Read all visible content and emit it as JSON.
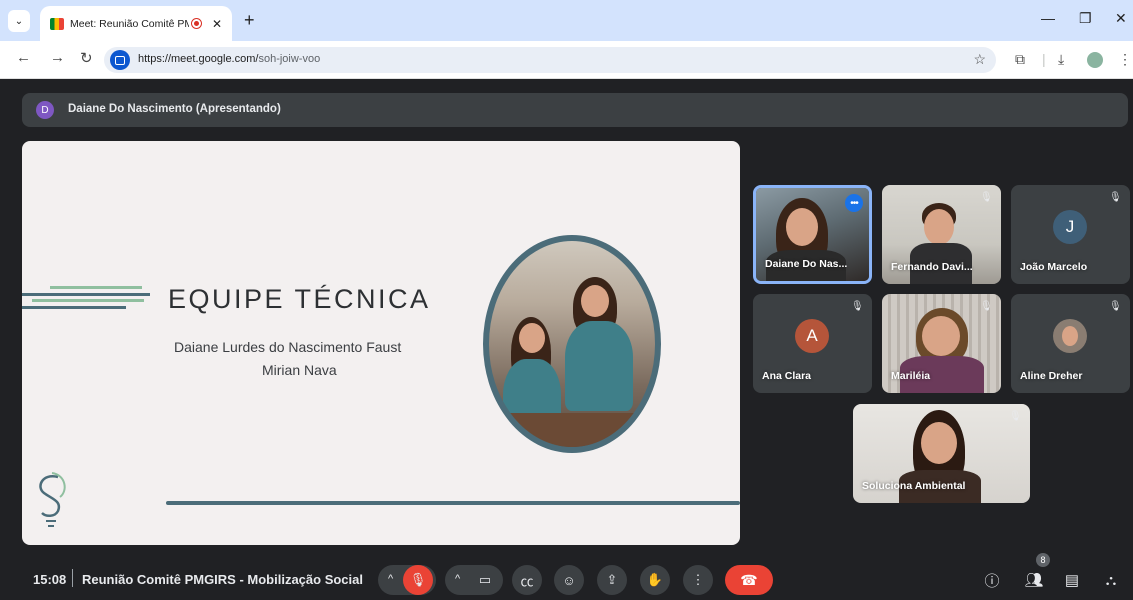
{
  "browser": {
    "tab_title": "Meet: Reunião Comitê PMG",
    "url_host": "https://meet.google.com/",
    "url_path": "soh-joiw-voo"
  },
  "presenter": {
    "initial": "D",
    "label": "Daiane Do Nascimento (Apresentando)"
  },
  "slide": {
    "title": "EQUIPE TÉCNICA",
    "name1": "Daiane Lurdes do Nascimento Faust",
    "name2": "Mirian Nava",
    "accent_color": "#4b6c79",
    "line_green": "#8fbf9f"
  },
  "participants": [
    {
      "name": "Daiane Do Nas...",
      "type": "video",
      "active": true
    },
    {
      "name": "Fernando Davi...",
      "type": "video",
      "muted": true
    },
    {
      "name": "João Marcelo",
      "type": "avatar",
      "initial": "J",
      "avatar_color": "#3f5f78",
      "muted": true
    },
    {
      "name": "Ana Clara",
      "type": "avatar",
      "initial": "A",
      "avatar_color": "#b5553a",
      "muted": true
    },
    {
      "name": "Mariléia",
      "type": "video",
      "muted": true
    },
    {
      "name": "Aline Dreher",
      "type": "photo-avatar",
      "muted": true
    },
    {
      "name": "Soluciona Ambiental",
      "type": "video",
      "muted": true
    }
  ],
  "footer": {
    "time": "15:08",
    "meeting_title": "Reunião Comitê PMGIRS - Mobilização Social",
    "participant_count": "8"
  }
}
